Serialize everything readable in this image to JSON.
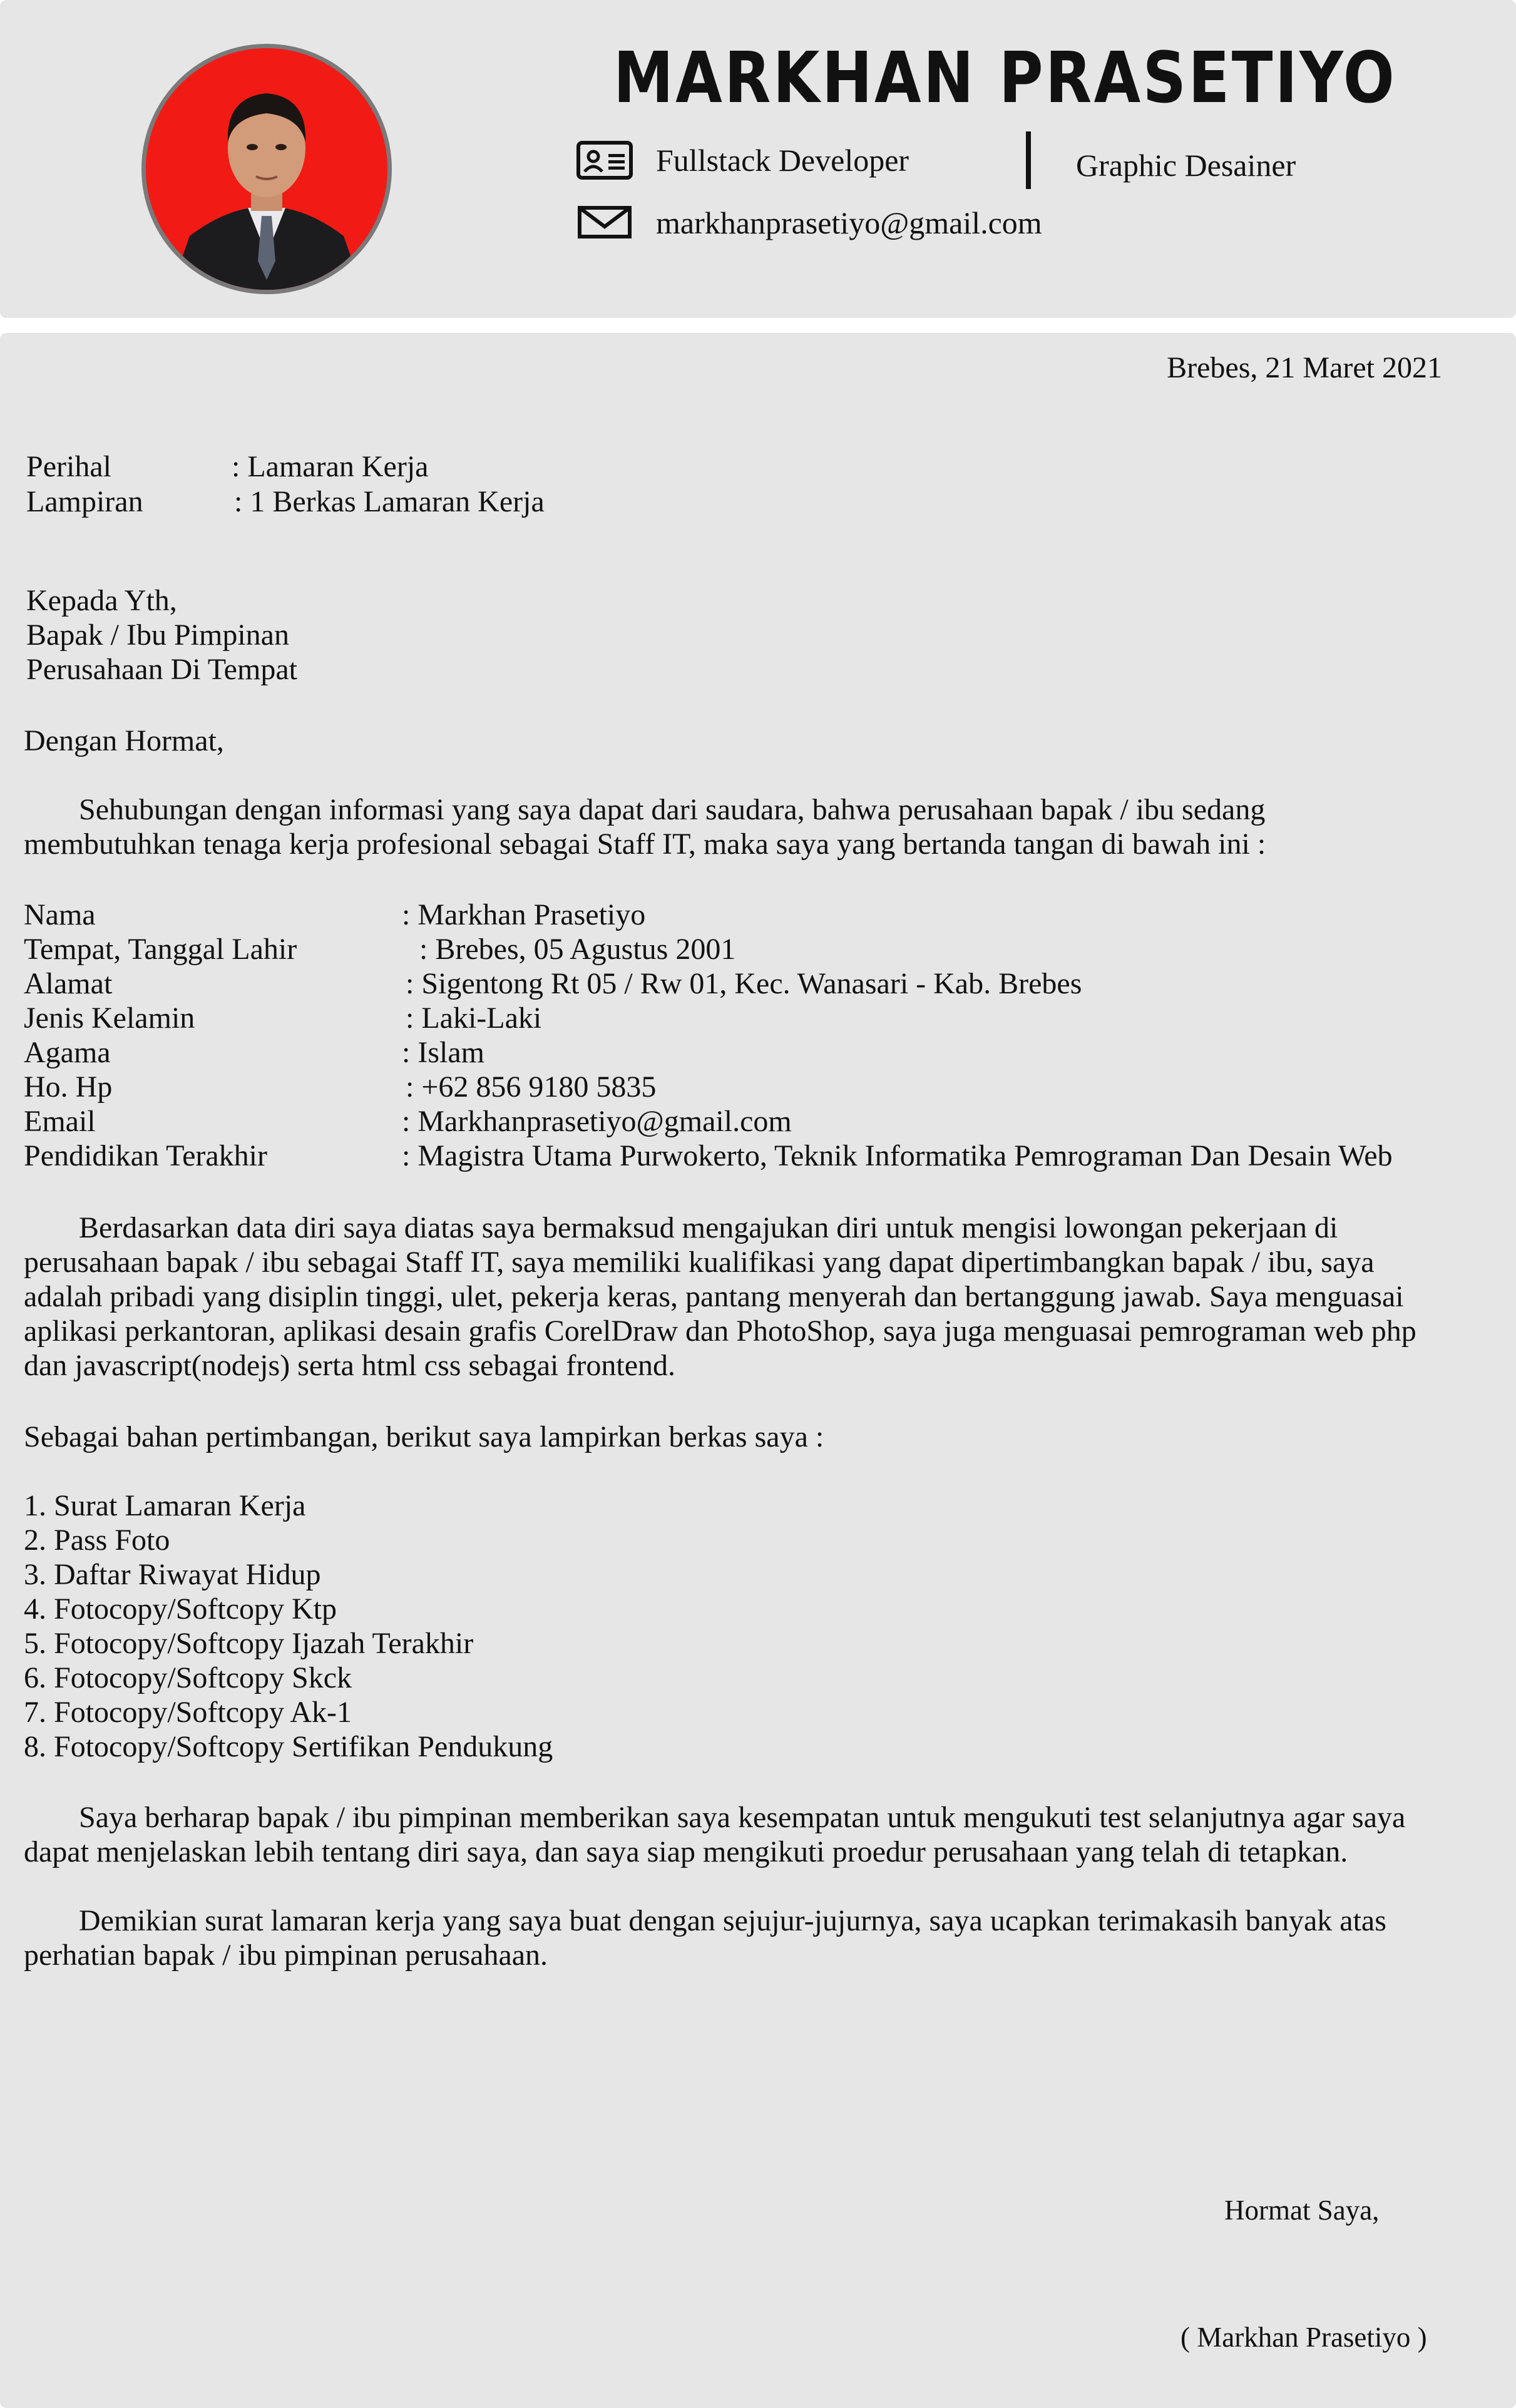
{
  "header": {
    "name": "MARKHAN PRASETIYO",
    "role_1": "Fullstack Developer",
    "role_2": "Graphic Desainer",
    "email": "markhanprasetiyo@gmail.com",
    "icons": [
      "id-card-icon",
      "envelope-icon"
    ],
    "avatar_background": "#f21a14"
  },
  "letter": {
    "place_date": "Brebes, 21 Maret 2021",
    "perihal_label": "Perihal",
    "perihal_value": ": Lamaran Kerja",
    "lampiran_label": "Lampiran",
    "lampiran_value": ": 1 Berkas Lamaran Kerja",
    "recipient": [
      "Kepada Yth,",
      "Bapak / Ibu Pimpinan",
      "Perusahaan Di Tempat"
    ],
    "greeting": "Dengan Hormat,",
    "intro": [
      "Sehubungan dengan informasi yang saya dapat dari saudara, bahwa perusahaan bapak / ibu sedang",
      "membutuhkan tenaga kerja profesional sebagai Staff IT, maka saya yang bertanda tangan di bawah ini :"
    ],
    "details": [
      {
        "label": "Nama",
        "value": ": Markhan Prasetiyo"
      },
      {
        "label": "Tempat, Tanggal Lahir",
        "value": ": Brebes, 05 Agustus 2001"
      },
      {
        "label": "Alamat",
        "value": ": Sigentong Rt 05 / Rw 01, Kec. Wanasari - Kab. Brebes"
      },
      {
        "label": "Jenis Kelamin",
        "value": ": Laki-Laki"
      },
      {
        "label": "Agama",
        "value": ": Islam"
      },
      {
        "label": "Ho. Hp",
        "value": ": +62 856 9180 5835"
      },
      {
        "label": "Email",
        "value": ": Markhanprasetiyo@gmail.com"
      },
      {
        "label": "Pendidikan Terakhir",
        "value": ": Magistra Utama Purwokerto, Teknik Informatika Pemrograman Dan Desain Web"
      }
    ],
    "body": [
      "Berdasarkan data diri saya diatas saya bermaksud mengajukan diri untuk mengisi lowongan pekerjaan di",
      "perusahaan bapak / ibu sebagai Staff IT,  saya memiliki kualifikasi yang dapat dipertimbangkan bapak / ibu, saya",
      "adalah pribadi yang disiplin tinggi, ulet, pekerja keras, pantang menyerah dan bertanggung jawab. Saya menguasai",
      "aplikasi perkantoran, aplikasi desain grafis CorelDraw dan PhotoShop, saya juga menguasai pemrograman web php",
      "dan javascript(nodejs) serta html css sebagai frontend."
    ],
    "attachments_intro": "Sebagai bahan pertimbangan, berikut saya lampirkan berkas saya :",
    "attachments": [
      "1. Surat Lamaran Kerja",
      "2. Pass Foto",
      "3. Daftar Riwayat Hidup",
      "4. Fotocopy/Softcopy Ktp",
      "5. Fotocopy/Softcopy Ijazah Terakhir",
      "6. Fotocopy/Softcopy Skck",
      "7. Fotocopy/Softcopy Ak-1",
      "8. Fotocopy/Softcopy Sertifikan Pendukung"
    ],
    "hope": [
      "Saya berharap bapak / ibu pimpinan memberikan saya kesempatan untuk mengukuti test selanjutnya agar saya",
      "dapat menjelaskan lebih tentang diri saya, dan saya siap mengikuti proedur perusahaan yang telah di tetapkan."
    ],
    "closing": [
      "Demikian surat lamaran kerja yang saya buat dengan sejujur-jujurnya, saya ucapkan terimakasih banyak atas",
      "perhatian bapak / ibu pimpinan perusahaan."
    ],
    "signoff": "Hormat Saya,",
    "signature_name": "( Markhan Prasetiyo )"
  }
}
